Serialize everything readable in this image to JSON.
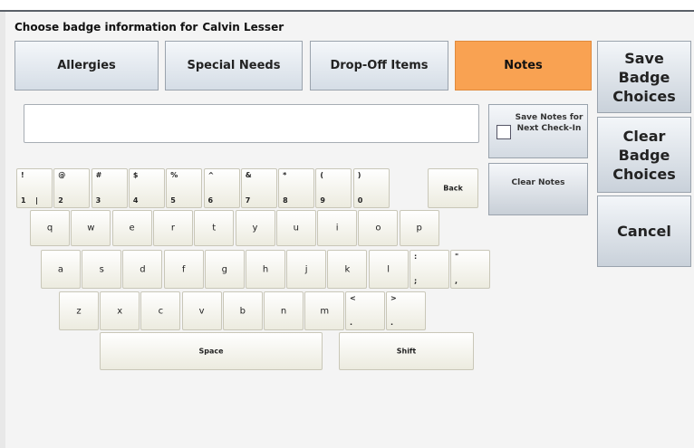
{
  "title": {
    "prefix": "Choose badge information for",
    "name": "Calvin Lesser"
  },
  "tabs": [
    {
      "label": "Allergies",
      "active": false
    },
    {
      "label": "Special Needs",
      "active": false
    },
    {
      "label": "Drop-Off Items",
      "active": false
    },
    {
      "label": "Notes",
      "active": true
    }
  ],
  "side_buttons": {
    "save": "Save Badge Choices",
    "clear": "Clear Badge Choices",
    "cancel": "Cancel"
  },
  "notes": {
    "value": "",
    "save_next_label": "Save Notes for Next Check-In",
    "save_next_checked": false,
    "clear_label": "Clear Notes"
  },
  "keyboard": {
    "number_row": [
      {
        "top": "!",
        "bottom": "1",
        "bottom2": "|"
      },
      {
        "top": "@",
        "bottom": "2"
      },
      {
        "top": "#",
        "bottom": "3"
      },
      {
        "top": "$",
        "bottom": "4"
      },
      {
        "top": "%",
        "bottom": "5"
      },
      {
        "top": "^",
        "bottom": "6"
      },
      {
        "top": "&",
        "bottom": "7"
      },
      {
        "top": "*",
        "bottom": "8"
      },
      {
        "top": "(",
        "bottom": "9"
      },
      {
        "top": ")",
        "bottom": "0"
      }
    ],
    "back": "Back",
    "row1": [
      "q",
      "w",
      "e",
      "r",
      "t",
      "y",
      "u",
      "i",
      "o",
      "p"
    ],
    "row2": [
      "a",
      "s",
      "d",
      "f",
      "g",
      "h",
      "j",
      "k",
      "l"
    ],
    "row2_extra": [
      {
        "top": ":",
        "bottom": ";"
      },
      {
        "top": "\"",
        "bottom": ","
      }
    ],
    "row3": [
      "z",
      "x",
      "c",
      "v",
      "b",
      "n",
      "m"
    ],
    "row3_extra": [
      {
        "top": "<",
        "bottom": "."
      },
      {
        "top": ">",
        "bottom": "."
      }
    ],
    "space": "Space",
    "shift": "Shift"
  },
  "colors": {
    "active_tab": "#f9a252",
    "frame_line": "#5a6068"
  }
}
